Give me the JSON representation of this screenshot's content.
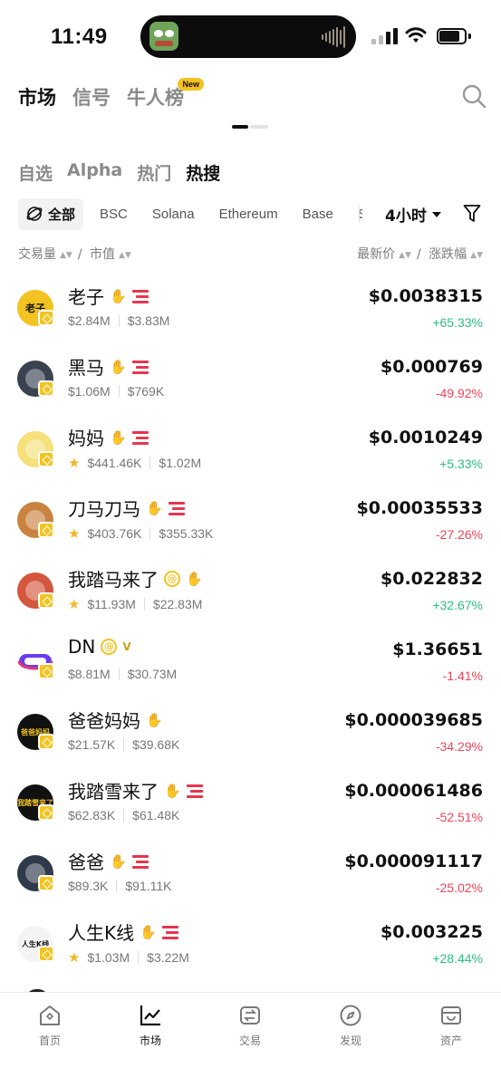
{
  "status": {
    "time": "11:49"
  },
  "top_tabs": [
    {
      "label": "市场",
      "active": true
    },
    {
      "label": "信号",
      "active": false
    },
    {
      "label": "牛人榜",
      "active": false,
      "badge": "New"
    }
  ],
  "sub_tabs": [
    {
      "label": "自选",
      "active": false
    },
    {
      "label": "Alpha",
      "active": false
    },
    {
      "label": "热门",
      "active": false
    },
    {
      "label": "热搜",
      "active": true
    }
  ],
  "chains": [
    {
      "label": "全部",
      "active": true
    },
    {
      "label": "BSC"
    },
    {
      "label": "Solana"
    },
    {
      "label": "Ethereum"
    },
    {
      "label": "Base"
    },
    {
      "label": "Sc"
    }
  ],
  "period": "4小时",
  "columns": {
    "volume": "交易量",
    "mcap": "市值",
    "price": "最新价",
    "change": "涨跌幅",
    "slash": "/"
  },
  "tokens": [
    {
      "name": "老子",
      "vol": "$2.84M",
      "mcap": "$3.83M",
      "price": "$0.0038315",
      "change": "+65.33%",
      "dir": "up",
      "star": false,
      "avatar_text": "老子",
      "avatar_bg": "#f3c321",
      "avatar_fg": "#111"
    },
    {
      "name": "黑马",
      "vol": "$1.06M",
      "mcap": "$769K",
      "price": "$0.000769",
      "change": "-49.92%",
      "dir": "down",
      "star": false,
      "avatar_text": "",
      "avatar_bg": "#3a4250",
      "avatar_fg": "#fff"
    },
    {
      "name": "妈妈",
      "vol": "$441.46K",
      "mcap": "$1.02M",
      "price": "$0.0010249",
      "change": "+5.33%",
      "dir": "up",
      "star": true,
      "avatar_text": "",
      "avatar_bg": "#f5e07a",
      "avatar_fg": "#111"
    },
    {
      "name": "刀马刀马",
      "vol": "$403.76K",
      "mcap": "$355.33K",
      "price": "$0.00035533",
      "change": "-27.26%",
      "dir": "down",
      "star": true,
      "avatar_text": "",
      "avatar_bg": "#c9823f",
      "avatar_fg": "#fff"
    },
    {
      "name": "我踏马来了",
      "vol": "$11.93M",
      "mcap": "$22.83M",
      "price": "$0.022832",
      "change": "+32.67%",
      "dir": "up",
      "star": true,
      "avatar_text": "",
      "avatar_bg": "#d4563c",
      "avatar_fg": "#fff"
    },
    {
      "name": "DN",
      "vol": "$8.81M",
      "mcap": "$30.73M",
      "price": "$1.36651",
      "change": "-1.41%",
      "dir": "down",
      "star": false,
      "avatar_text": "",
      "avatar_bg": "#ffffff",
      "avatar_fg": "#fff"
    },
    {
      "name": "爸爸妈妈",
      "vol": "$21.57K",
      "mcap": "$39.68K",
      "price": "$0.000039685",
      "change": "-34.29%",
      "dir": "down",
      "star": false,
      "avatar_text": "爸爸妈妈",
      "avatar_bg": "#111111",
      "avatar_fg": "#f3c321"
    },
    {
      "name": "我踏雪来了",
      "vol": "$62.83K",
      "mcap": "$61.48K",
      "price": "$0.000061486",
      "change": "-52.51%",
      "dir": "down",
      "star": false,
      "avatar_text": "我踏雪来了",
      "avatar_bg": "#111111",
      "avatar_fg": "#f3c321"
    },
    {
      "name": "爸爸",
      "vol": "$89.3K",
      "mcap": "$91.11K",
      "price": "$0.000091117",
      "change": "-25.02%",
      "dir": "down",
      "star": false,
      "avatar_text": "",
      "avatar_bg": "#2e3a4a",
      "avatar_fg": "#fff"
    },
    {
      "name": "人生K线",
      "vol": "$1.03M",
      "mcap": "$3.22M",
      "price": "$0.003225",
      "change": "+28.44%",
      "dir": "up",
      "star": true,
      "avatar_text": "人生K线",
      "avatar_bg": "#f4f4f4",
      "avatar_fg": "#111"
    }
  ],
  "bottom_nav": [
    {
      "label": "首页",
      "icon": "home-icon",
      "active": false
    },
    {
      "label": "市场",
      "icon": "chart-icon",
      "active": true
    },
    {
      "label": "交易",
      "icon": "swap-icon",
      "active": false
    },
    {
      "label": "发现",
      "icon": "compass-icon",
      "active": false
    },
    {
      "label": "资产",
      "icon": "wallet-icon",
      "active": false
    }
  ],
  "colors": {
    "up": "#2ebd85",
    "down": "#f0445a",
    "accent": "#f3c321"
  }
}
